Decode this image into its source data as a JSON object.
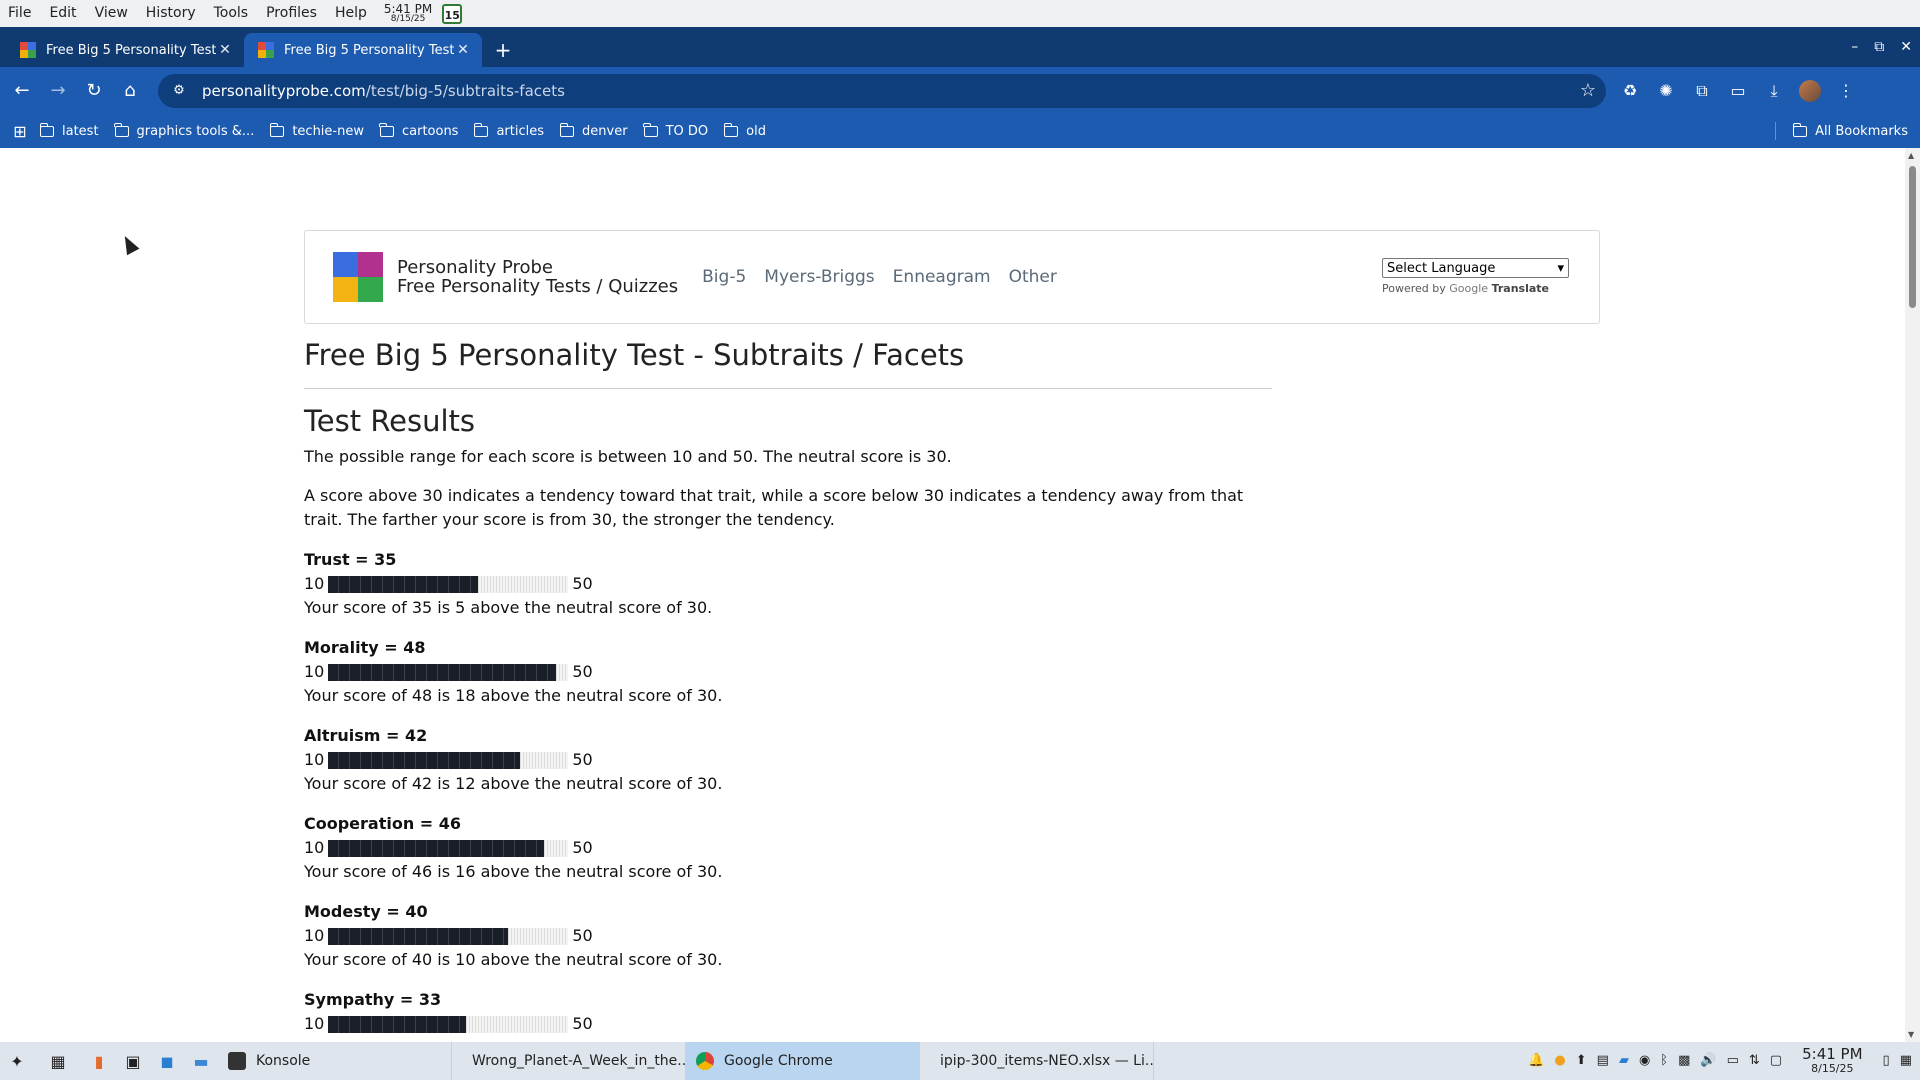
{
  "menubar": {
    "items": [
      "File",
      "Edit",
      "View",
      "History",
      "Tools",
      "Profiles",
      "Help"
    ],
    "clock_time": "5:41 PM",
    "clock_date": "8/15/25",
    "calendar_day": "15"
  },
  "tabs": [
    {
      "title": "Free Big 5 Personality Test -",
      "close": "✕"
    },
    {
      "title": "Free Big 5 Personality Test",
      "close": "✕"
    }
  ],
  "new_tab": "+",
  "window_controls": {
    "minimize": "–",
    "restore": "⧉",
    "close": "✕"
  },
  "toolbar": {
    "back": "←",
    "forward": "→",
    "reload": "↻",
    "home": "⌂",
    "url_host": "personalityprobe.com",
    "url_path": "/test/big-5/subtraits-facets",
    "star": "☆"
  },
  "bookmarks": {
    "items": [
      "latest",
      "graphics tools &...",
      "techie-new",
      "cartoons",
      "articles",
      "denver",
      "TO DO",
      "old"
    ],
    "all_bookmarks": "All Bookmarks"
  },
  "site": {
    "brand_line1": "Personality Probe",
    "brand_line2": "Free Personality Tests / Quizzes",
    "nav": [
      "Big-5",
      "Myers-Briggs",
      "Enneagram",
      "Other"
    ],
    "language_select": "Select Language",
    "powered_by": "Powered by",
    "google": "Google",
    "translate": "Translate"
  },
  "content": {
    "page_title": "Free Big 5 Personality Test - Subtraits / Facets",
    "results_heading": "Test Results",
    "para1": "The possible range for each score is between 10 and 50. The neutral score is 30.",
    "para2": "A score above 30 indicates a tendency toward that trait, while a score below 30 indicates a tendency away from that trait. The farther your score is from 30, the stronger the tendency.",
    "min_label": "10",
    "max_label": "50",
    "traits": [
      {
        "heading": "Trust = 35",
        "score": 35,
        "summary": "Your score of 35 is 5 above the neutral score of 30."
      },
      {
        "heading": "Morality = 48",
        "score": 48,
        "summary": "Your score of 48 is 18 above the neutral score of 30."
      },
      {
        "heading": "Altruism = 42",
        "score": 42,
        "summary": "Your score of 42 is 12 above the neutral score of 30."
      },
      {
        "heading": "Cooperation = 46",
        "score": 46,
        "summary": "Your score of 46 is 16 above the neutral score of 30."
      },
      {
        "heading": "Modesty = 40",
        "score": 40,
        "summary": "Your score of 40 is 10 above the neutral score of 30."
      },
      {
        "heading": "Sympathy = 33",
        "score": 33,
        "summary": ""
      }
    ]
  },
  "taskbar": {
    "tasks": [
      "Konsole",
      "Wrong_Planet-A_Week_in_the...",
      "Google Chrome",
      "ipip-300_items-NEO.xlsx — Li..."
    ],
    "clock_time": "5:41 PM",
    "clock_date": "8/15/25"
  },
  "colors": {
    "tab_strip": "#103a72",
    "toolbar": "#1c5bb0",
    "bar_fill": "#1a1f27"
  }
}
